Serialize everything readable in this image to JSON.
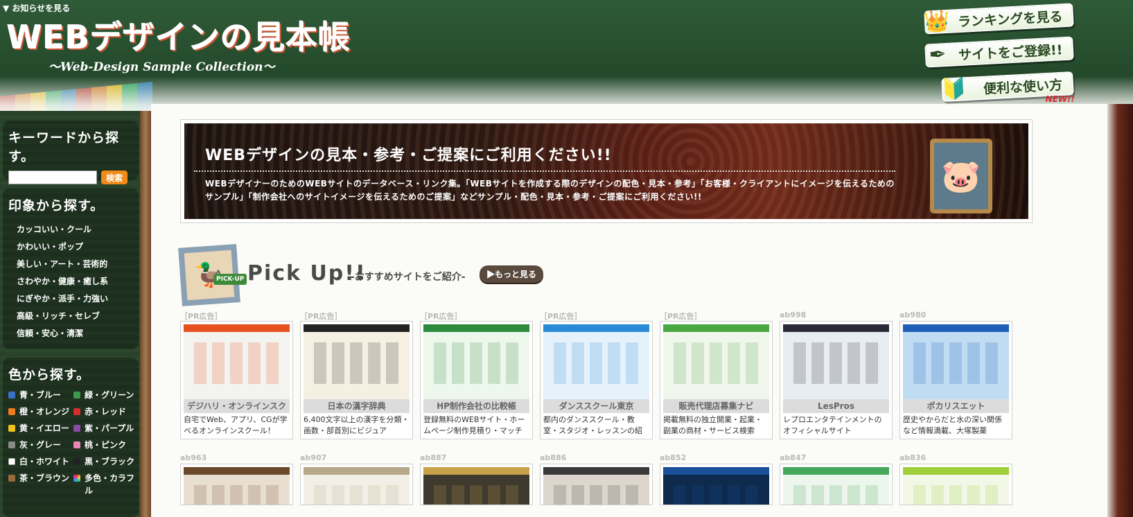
{
  "header": {
    "notice_link": "▼ お知らせを見る",
    "logo_title": "WEBデザインの見本帳",
    "logo_subtitle": "～Web-Design Sample Collection～",
    "ranking_button": "ランキングを見る",
    "register_button": "サイトをご登録!!",
    "usage_button": "便利な使い方",
    "usage_badge": "NEW!!"
  },
  "sidebar": {
    "keyword_title": "キーワードから探す。",
    "search_button": "検索",
    "search_value": "",
    "impression_title": "印象から探す。",
    "impression_items": [
      "カッコいい・クール",
      "かわいい・ポップ",
      "美しい・アート・芸術的",
      "さわやか・健康・癒し系",
      "にぎやか・派手・力強い",
      "高級・リッチ・セレブ",
      "信頼・安心・清潔"
    ],
    "color_title": "色から探す。",
    "colors": [
      {
        "label": "青・ブルー",
        "color": "#3a6fc4"
      },
      {
        "label": "緑・グリーン",
        "color": "#3d9a4d"
      },
      {
        "label": "橙・オレンジ",
        "color": "#ee7d1b"
      },
      {
        "label": "赤・レッド",
        "color": "#d82c2c"
      },
      {
        "label": "黄・イエロー",
        "color": "#f1c21c"
      },
      {
        "label": "紫・パープル",
        "color": "#8a4aa8"
      },
      {
        "label": "灰・グレー",
        "color": "#8a8a8a"
      },
      {
        "label": "桃・ピンク",
        "color": "#e887b4"
      },
      {
        "label": "白・ホワイト",
        "color": "#ffffff"
      },
      {
        "label": "黒・ブラック",
        "color": "#222222"
      },
      {
        "label": "茶・ブラウン",
        "color": "#9b6a3c"
      },
      {
        "label": "多色・カラフル",
        "color": "conic-gradient(#e33,#fc3,#3c6,#39f,#c3c,#e33)"
      }
    ]
  },
  "hero": {
    "title": "WEBデザインの見本・参考・ご提案にご利用ください!!",
    "description": "WEBデザイナーのためのWEBサイトのデータベース・リンク集。「WEBサイトを作成する際のデザインの配色・見本・参考」「お客様・クライアントにイメージを伝えるためのサンプル」「制作会社へのサイトイメージを伝えるためのご提案」などサンプル・配色・見本・参考・ご提案にご利用ください!!"
  },
  "pickup": {
    "badge": "PICK-UP",
    "title": "Pick Up!!",
    "subtitle": "-おすすめサイトをご紹介-",
    "more_button": "▶もっと見る"
  },
  "sites_row1": [
    {
      "id": "［PR広告］",
      "name": "デジハリ・オンラインスク",
      "desc": "自宅でWeb、アプリ、CGが学べるオンラインスクール！",
      "accent": "#e8501e",
      "bg": "#f3f3ef"
    },
    {
      "id": "［PR広告］",
      "name": "日本の漢字辞典",
      "desc": "6,400文字以上の漢字を分類・画数・部首別にビジュア",
      "accent": "#222222",
      "bg": "#f6f0e2"
    },
    {
      "id": "［PR広告］",
      "name": "HP制作会社の比較帳",
      "desc": "登録無料のWEBサイト・ホームページ制作見積り・マッチ",
      "accent": "#2c8a3d",
      "bg": "#eef7ec"
    },
    {
      "id": "［PR広告］",
      "name": "ダンススクール東京",
      "desc": "都内のダンススクール・教室・スタジオ・レッスンの紹",
      "accent": "#2a8ad6",
      "bg": "#e6f2fb"
    },
    {
      "id": "［PR広告］",
      "name": "販売代理店募集ナビ",
      "desc": "掲載無料の独立開業・起業・副業の商材・サービス検索",
      "accent": "#4aa843",
      "bg": "#f1f6ec"
    },
    {
      "id": "ab998",
      "name": "LesPros",
      "desc": "レプロエンタテインメントのオフィシャルサイト",
      "accent": "#2a2a36",
      "bg": "#e8edf2"
    },
    {
      "id": "ab980",
      "name": "ポカリスエット",
      "desc": "歴史やからだと水の深い関係など情報満載、大塚製薬",
      "accent": "#1e5fb8",
      "bg": "#bfdcf3"
    }
  ],
  "sites_row2": [
    {
      "id": "ab963",
      "accent": "#6b4a2b",
      "bg": "#e9dfd1"
    },
    {
      "id": "ab907",
      "accent": "#b8a88a",
      "bg": "#f3efe6"
    },
    {
      "id": "ab887",
      "accent": "#c9a04a",
      "bg": "#3e3a2e"
    },
    {
      "id": "ab886",
      "accent": "#3a3a3a",
      "bg": "#dcd6cc"
    },
    {
      "id": "ab852",
      "accent": "#1a4f9a",
      "bg": "#0e2a4d"
    },
    {
      "id": "ab847",
      "accent": "#45a85a",
      "bg": "#edf6ec"
    },
    {
      "id": "ab836",
      "accent": "#9fcf3b",
      "bg": "#f2f7e6"
    }
  ]
}
